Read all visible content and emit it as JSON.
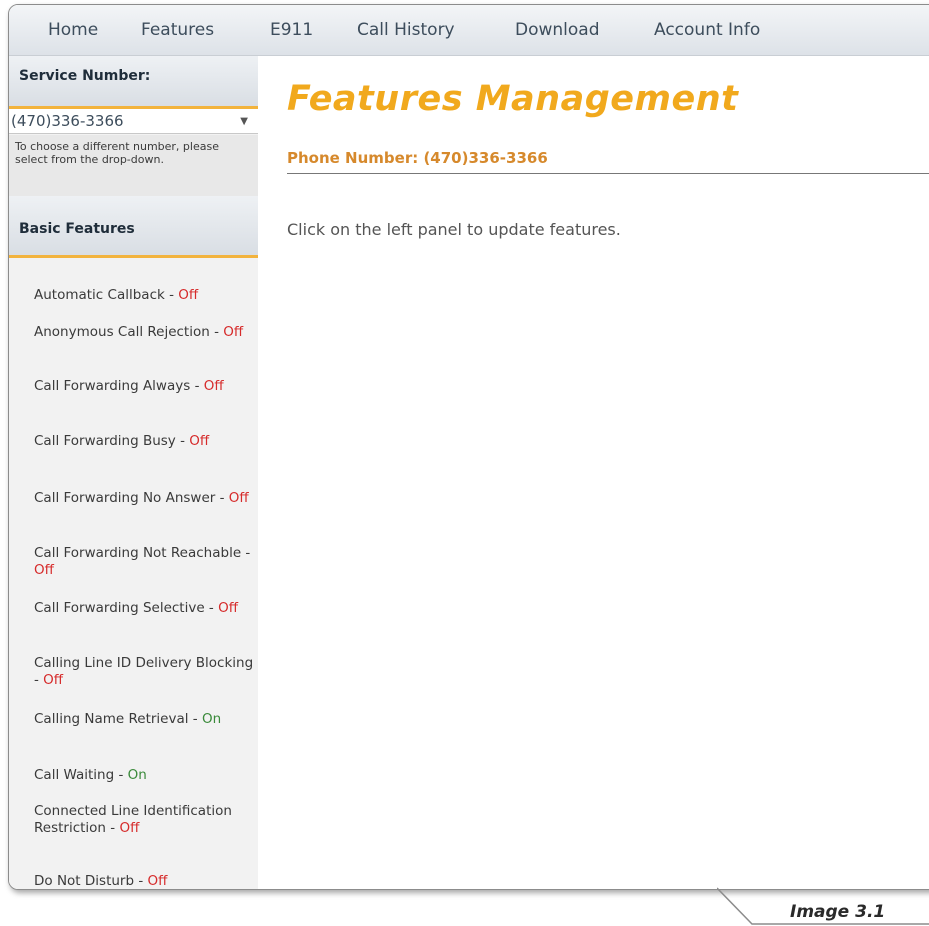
{
  "nav": {
    "items": [
      "Home",
      "Features",
      "E911",
      "Call History",
      "Download",
      "Account Info"
    ]
  },
  "sidebar": {
    "service_header": "Service Number:",
    "selected_number": "(470)336-3366",
    "hint": "To choose a different number, please select from the drop-down.",
    "features_header": "Basic Features",
    "features": [
      {
        "name": "Automatic Callback - ",
        "status": "Off"
      },
      {
        "name": "Anonymous Call Rejection - ",
        "status": "Off"
      },
      {
        "name": "Call Forwarding Always - ",
        "status": "Off"
      },
      {
        "name": "Call Forwarding Busy - ",
        "status": "Off"
      },
      {
        "name": "Call Forwarding No Answer - ",
        "status": "Off"
      },
      {
        "name": "Call Forwarding Not Reachable - ",
        "status": "Off"
      },
      {
        "name": "Call Forwarding Selective - ",
        "status": "Off"
      },
      {
        "name": "Calling Line ID Delivery Blocking - ",
        "status": "Off"
      },
      {
        "name": "Calling Name Retrieval - ",
        "status": "On"
      },
      {
        "name": "Call Waiting - ",
        "status": "On"
      },
      {
        "name": "Connected Line Identification Restriction - ",
        "status": "Off"
      },
      {
        "name": "Do Not Disturb - ",
        "status": "Off"
      }
    ]
  },
  "main": {
    "title": "Features Management",
    "phone_line": "Phone Number: (470)336-3366",
    "instructions": "Click on the left panel to update features."
  },
  "caption": "Image 3.1",
  "colors": {
    "accent_orange": "#f1a91d",
    "status_off": "#d62b2b",
    "status_on": "#3a8a3a"
  }
}
